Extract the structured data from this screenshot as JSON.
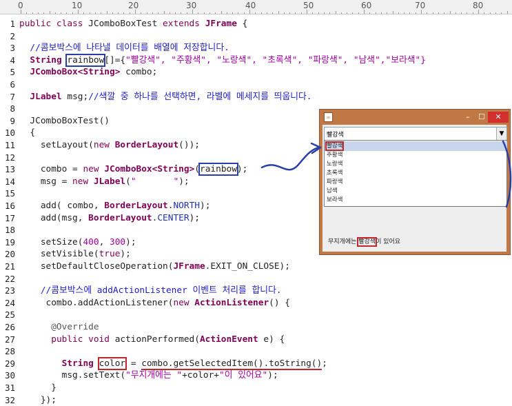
{
  "ruler": {
    "labels": [
      "0",
      "10",
      "20",
      "30",
      "40",
      "50",
      "60",
      "70",
      "80"
    ]
  },
  "line_numbers": [
    "1",
    "2",
    "3",
    "4",
    "5",
    "6",
    "7",
    "8",
    "9",
    "10",
    "11",
    "12",
    "13",
    "14",
    "15",
    "16",
    "17",
    "18",
    "19",
    "20",
    "21",
    "22",
    "23",
    "24",
    "25",
    "26",
    "27",
    "28",
    "29",
    "30",
    "31",
    "32"
  ],
  "code": {
    "l1_a": "public class",
    "l1_b": " JComboBoxTest ",
    "l1_c": "extends",
    "l1_d": " ",
    "l1_e": "JFrame",
    "l1_f": " {",
    "l3": "  //콤보박스에 나타낼 데이터를 배열에 저장합니다.",
    "l4_a": "  ",
    "l4_b": "String",
    "l4_c": " ",
    "l4_d": "rainbow",
    "l4_e": "[]={",
    "l4_f": "\"빨강색\", \"주황색\", \"노랑색\", \"초록색\", \"파랑색\", \"남색\",\"보라색\"}",
    "l5_a": "  ",
    "l5_b": "JComboBox<String>",
    "l5_c": " combo;",
    "l7_a": "  ",
    "l7_b": "JLabel",
    "l7_c": " msg;",
    "l7_d": "//색깔 중 하나를 선택하면, 라벨에 메세지를 띄웁니다.",
    "l9": "  JComboBoxTest()",
    "l10": "  {",
    "l11_a": "    setLayout(",
    "l11_b": "new",
    "l11_c": " ",
    "l11_d": "BorderLayout",
    "l11_e": "());",
    "l13_a": "    combo = ",
    "l13_b": "new",
    "l13_c": " ",
    "l13_d": "JComboBox<String>",
    "l13_e": "(",
    "l13_f": "rainbow",
    "l13_g": ");",
    "l14_a": "    msg = ",
    "l14_b": "new",
    "l14_c": " ",
    "l14_d": "JLabel",
    "l14_e": "(",
    "l14_f": "\"       \"",
    "l14_g": ");",
    "l16_a": "    add( combo, ",
    "l16_b": "BorderLayout",
    "l16_c": ".",
    "l16_d": "NORTH",
    "l16_e": ");",
    "l17_a": "    add(msg, ",
    "l17_b": "BorderLayout",
    "l17_c": ".",
    "l17_d": "CENTER",
    "l17_e": ");",
    "l19_a": "    setSize(",
    "l19_b": "400",
    "l19_c": ", ",
    "l19_d": "300",
    "l19_e": ");",
    "l20_a": "    setVisible(",
    "l20_b": "true",
    "l20_c": ");",
    "l21_a": "    setDefaultCloseOperation(",
    "l21_b": "JFrame",
    "l21_c": ".EXIT_ON_CLOSE);",
    "l23": "    //콤보박스에 addActionListener 이벤트 처리를 합니다.",
    "l24_a": "     combo.addActionListener(",
    "l24_b": "new",
    "l24_c": " ",
    "l24_d": "ActionListener",
    "l24_e": "() {",
    "l26": "      @Override",
    "l27_a": "      ",
    "l27_b": "public void",
    "l27_c": " actionPerformed(",
    "l27_d": "ActionEvent",
    "l27_e": " e) {",
    "l29_a": "        ",
    "l29_b": "String",
    "l29_c": " ",
    "l29_d": "color",
    "l29_e": " = ",
    "l29_f": "combo.getSelectedItem().toString()",
    "l29_g": ";",
    "l30_a": "        msg.setText(",
    "l30_b": "\"무지개에는 \"",
    "l30_c": "+color+",
    "l30_d": "\"이 있어요\"",
    "l30_e": ");",
    "l31": "      }",
    "l32": "    });"
  },
  "window": {
    "title_icon": "java-icon",
    "minimize": "–",
    "maximize": "☐",
    "close": "✕",
    "combo_value": "빨강색",
    "combo_arrow": "▼",
    "items": [
      "빨강색",
      "주황색",
      "노랑색",
      "초록색",
      "파랑색",
      "남색",
      "보라색"
    ],
    "message_prefix": "무지개에는 ",
    "message_color": "빨강색",
    "message_suffix": "이 있어요"
  },
  "colors": {
    "annotation_blue": "#2a3ea8",
    "annotation_red": "#c0262b",
    "window_frame": "#c07845"
  }
}
